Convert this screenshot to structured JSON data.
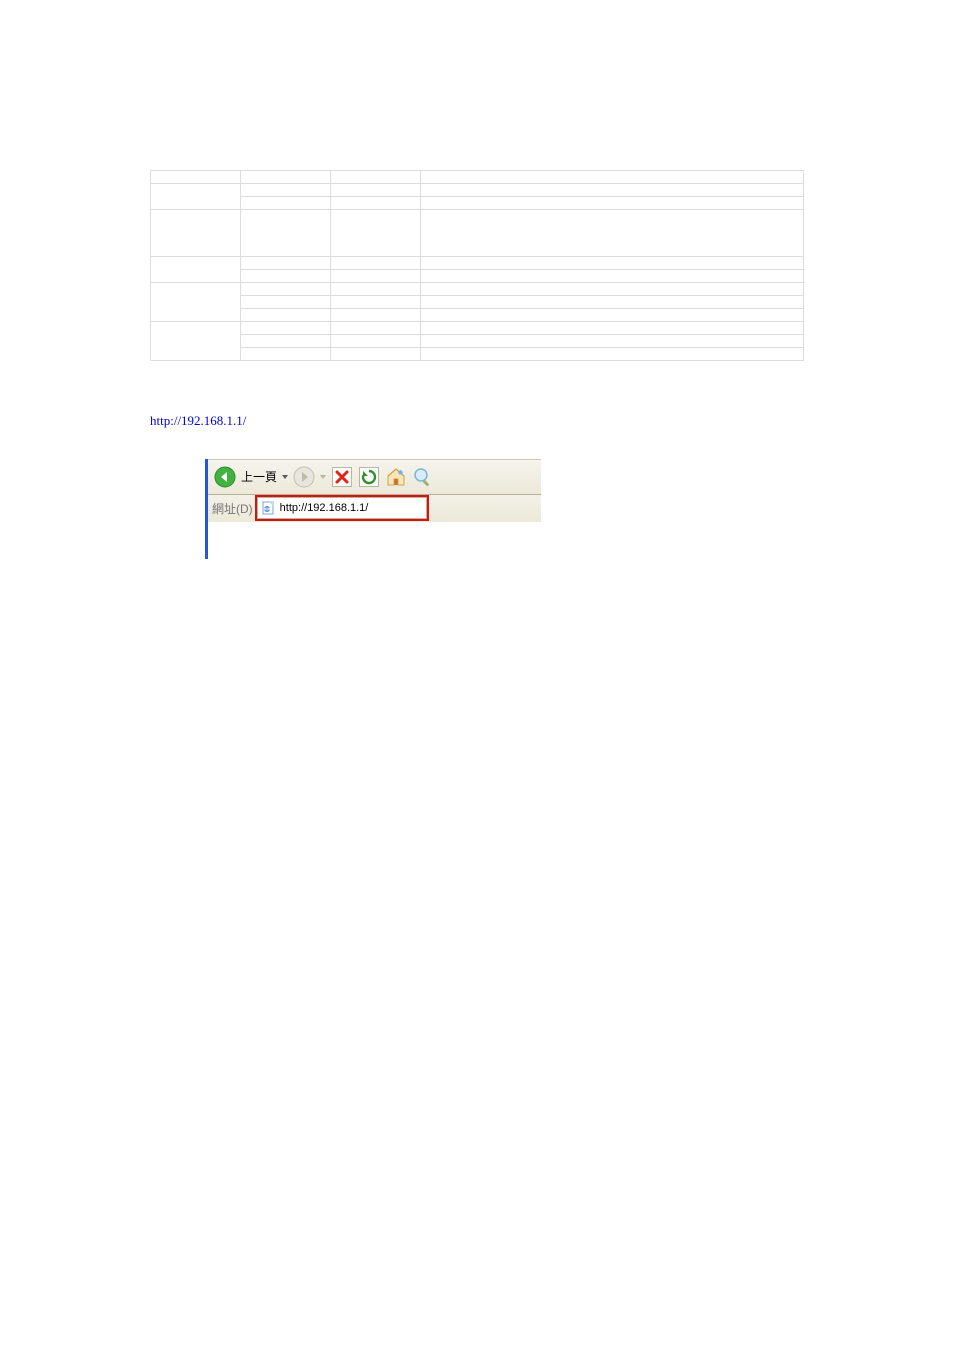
{
  "table": {
    "rows": [
      {
        "c1": "",
        "c2": "",
        "c3": "",
        "c4": ""
      },
      {
        "c1_rowspan": 2,
        "c1": "",
        "c2": "",
        "c3": "",
        "c4": ""
      },
      {
        "c2": "",
        "c3": "",
        "c4": ""
      },
      {
        "c1": "",
        "c2": "",
        "c3": "",
        "c4": ""
      },
      {
        "c1_rowspan": 2,
        "c1": "",
        "c2": "",
        "c3": "",
        "c4": ""
      },
      {
        "c2": "",
        "c3": "",
        "c4": ""
      },
      {
        "c1_rowspan": 3,
        "c1": "",
        "c2": "",
        "c3": "",
        "c4": ""
      },
      {
        "c2": "",
        "c3": "",
        "c4": ""
      },
      {
        "c2": "",
        "c3": "",
        "c4": ""
      },
      {
        "c1_rowspan": 3,
        "c1": "",
        "c2": "",
        "c3": "",
        "c4": ""
      },
      {
        "c2": "",
        "c3": "",
        "c4": ""
      },
      {
        "c2": "",
        "c3": "",
        "c4": ""
      }
    ]
  },
  "headings": {
    "h1": "",
    "h2": ""
  },
  "body": {
    "p1_prefix": "",
    "p1_ip": "http://192.168.1.1/",
    "p1_suffix": "",
    "note": ""
  },
  "browser": {
    "back_label": "上一頁",
    "addr_label": "網址(D)",
    "addr_value": "http://192.168.1.1/"
  }
}
